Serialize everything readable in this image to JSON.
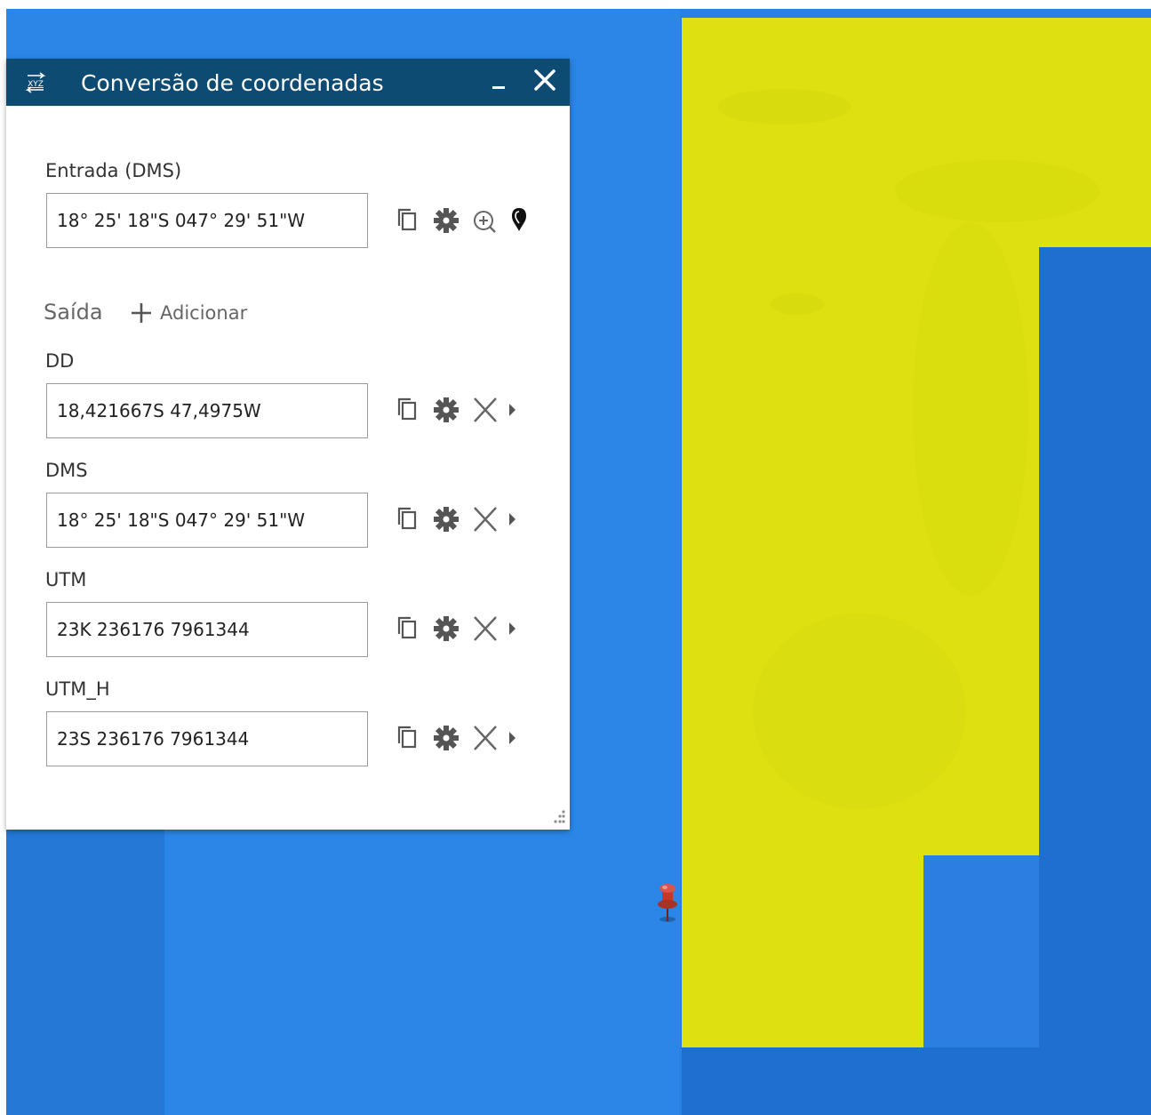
{
  "widget": {
    "title": "Conversão de coordenadas",
    "title_icon": "xyz-convert-icon",
    "minimize_icon": "minimize-icon",
    "close_icon": "close-icon"
  },
  "input": {
    "label": "Entrada (DMS)",
    "value": "18° 25' 18\"S 047° 29' 51\"W",
    "actions": [
      "copy-icon",
      "gear-icon",
      "zoom-in-icon",
      "map-pin-icon"
    ]
  },
  "output": {
    "heading": "Saída",
    "add_label": "Adicionar",
    "items": [
      {
        "label": "DD",
        "value": "18,421667S 47,4975W"
      },
      {
        "label": "DMS",
        "value": "18° 25' 18\"S 047° 29' 51\"W"
      },
      {
        "label": "UTM",
        "value": "23K 236176 7961344"
      },
      {
        "label": "UTM_H",
        "value": "23S 236176 7961344"
      }
    ],
    "actions": [
      "copy-icon",
      "gear-icon",
      "remove-icon",
      "expand-arrow-icon"
    ]
  },
  "colors": {
    "titlebar": "#0e4b73",
    "map_water": "#2b86e8",
    "map_highlight": "#dfe010",
    "pin": "#c0392b"
  }
}
